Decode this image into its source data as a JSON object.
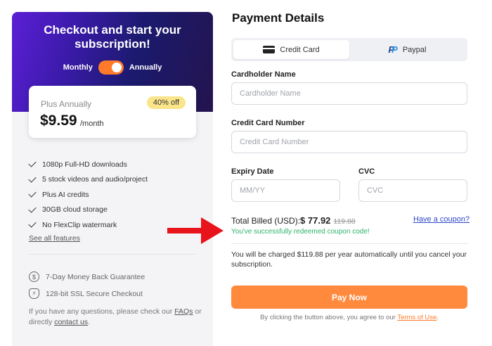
{
  "left": {
    "hero_title_line1": "Checkout and start your",
    "hero_title_line2": "subscription!",
    "toggle": {
      "left_label": "Monthly",
      "right_label": "Annually",
      "selected": "Annually"
    },
    "plan": {
      "name": "Plus Annually",
      "badge": "40% off",
      "price": "$9.59",
      "unit": "/month"
    },
    "features": [
      "1080p Full-HD downloads",
      "5 stock videos and audio/project",
      "Plus AI credits",
      "30GB cloud storage",
      "No FlexClip watermark"
    ],
    "see_all": "See all features",
    "guarantees": [
      {
        "icon": "dollar-refund-icon",
        "text": "7-Day Money Back Guarantee"
      },
      {
        "icon": "shield-icon",
        "text": "128-bit SSL Secure Checkout"
      }
    ],
    "help": {
      "prefix": "If you have any questions, please check our ",
      "faq": "FAQs",
      "middle": " or directly ",
      "contact": "contact us",
      "suffix": "."
    }
  },
  "right": {
    "title": "Payment Details",
    "tabs": [
      {
        "label": "Credit Card",
        "icon": "credit-card-icon",
        "active": true
      },
      {
        "label": "Paypal",
        "icon": "paypal-icon",
        "active": false
      }
    ],
    "fields": {
      "cardholder": {
        "label": "Cardholder Name",
        "placeholder": "Cardholder Name"
      },
      "card_number": {
        "label": "Credit Card Number",
        "placeholder": "Credit Card Number"
      },
      "expiry": {
        "label": "Expiry Date",
        "placeholder": "MM/YY"
      },
      "cvc": {
        "label": "CVC",
        "placeholder": "CVC"
      }
    },
    "total": {
      "label": "Total Billed (USD):",
      "amount": "$ 77.92",
      "old": "119.88"
    },
    "coupon_link": "Have a coupon?",
    "success": "You've successfully redeemed coupon code!",
    "charge_note": "You will be charged $119.88 per year automatically until you cancel your subscription.",
    "pay_button": "Pay Now",
    "terms": {
      "prefix": "By clicking the button above, you agree to our ",
      "link": "Terms of Use",
      "suffix": "."
    }
  },
  "colors": {
    "accent": "#ff8a3d",
    "success": "#2db36b",
    "link": "#2f49c8",
    "arrow": "#e8141c"
  }
}
